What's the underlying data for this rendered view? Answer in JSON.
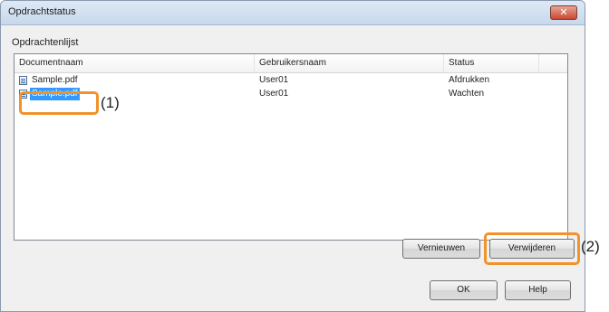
{
  "window": {
    "title": "Opdrachtstatus",
    "close_glyph": "✕"
  },
  "list": {
    "label": "Opdrachtenlijst",
    "columns": [
      "Documentnaam",
      "Gebruikersnaam",
      "Status"
    ],
    "rows": [
      {
        "name": "Sample.pdf",
        "user": "User01",
        "status": "Afdrukken"
      },
      {
        "name": "Sample.pdf",
        "user": "User01",
        "status": "Wachten",
        "selected": true
      }
    ]
  },
  "buttons": {
    "refresh": "Vernieuwen",
    "delete": "Verwijderen",
    "ok": "OK",
    "help": "Help"
  },
  "callouts": {
    "one": "(1)",
    "two": "(2)"
  },
  "colors": {
    "highlight": "#f0932b",
    "selection": "#3399ff"
  }
}
